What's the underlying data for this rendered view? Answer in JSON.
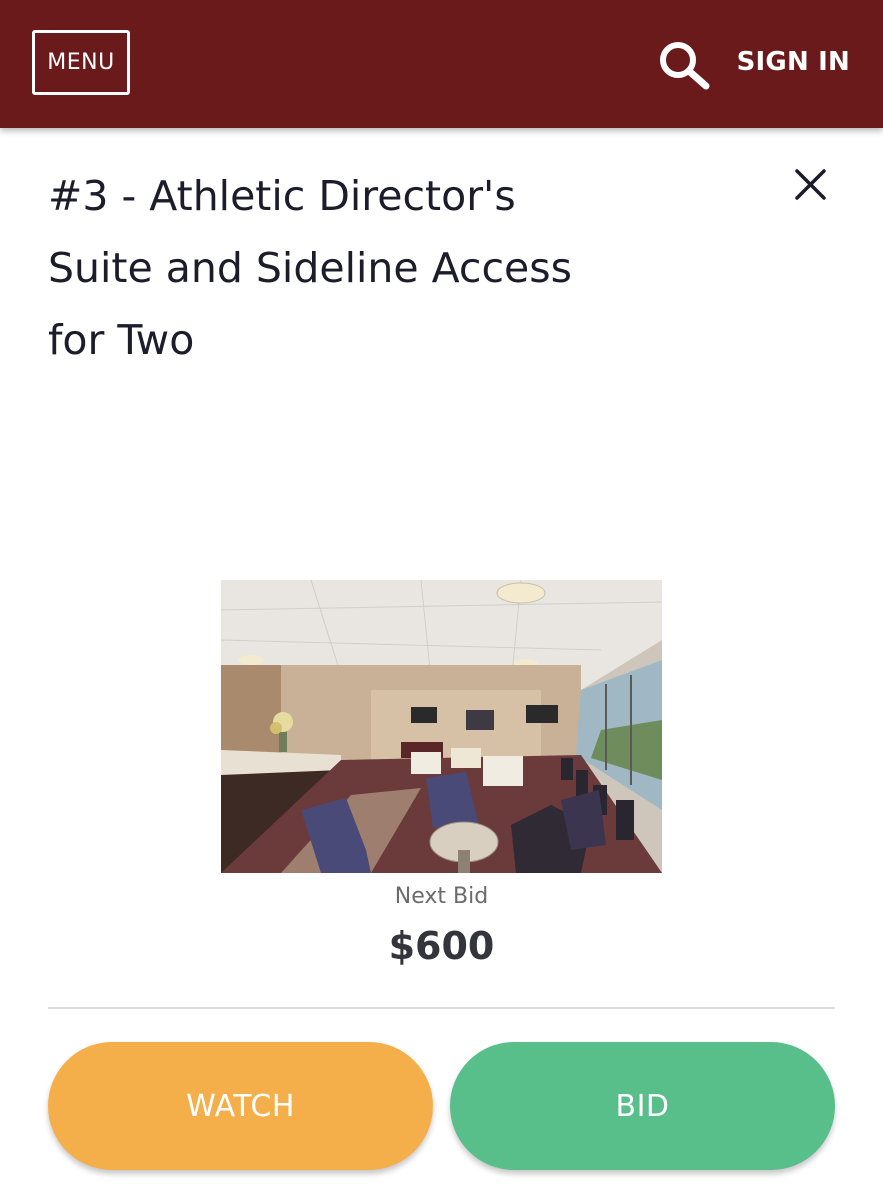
{
  "header": {
    "menu_label": "MENU",
    "search_icon": "search-icon",
    "signin_label": "SIGN IN",
    "background_color": "#6b1a1b"
  },
  "item": {
    "title": "#3 - Athletic Director's Suite and Sideline Access for Two",
    "close_icon": "close-icon",
    "image": "photo of stadium suite lounge interior",
    "next_bid_label": "Next Bid",
    "next_bid_amount": "$600"
  },
  "actions": {
    "watch_label": "WATCH",
    "watch_color": "#f5af4a",
    "bid_label": "BID",
    "bid_color": "#58be8a"
  }
}
